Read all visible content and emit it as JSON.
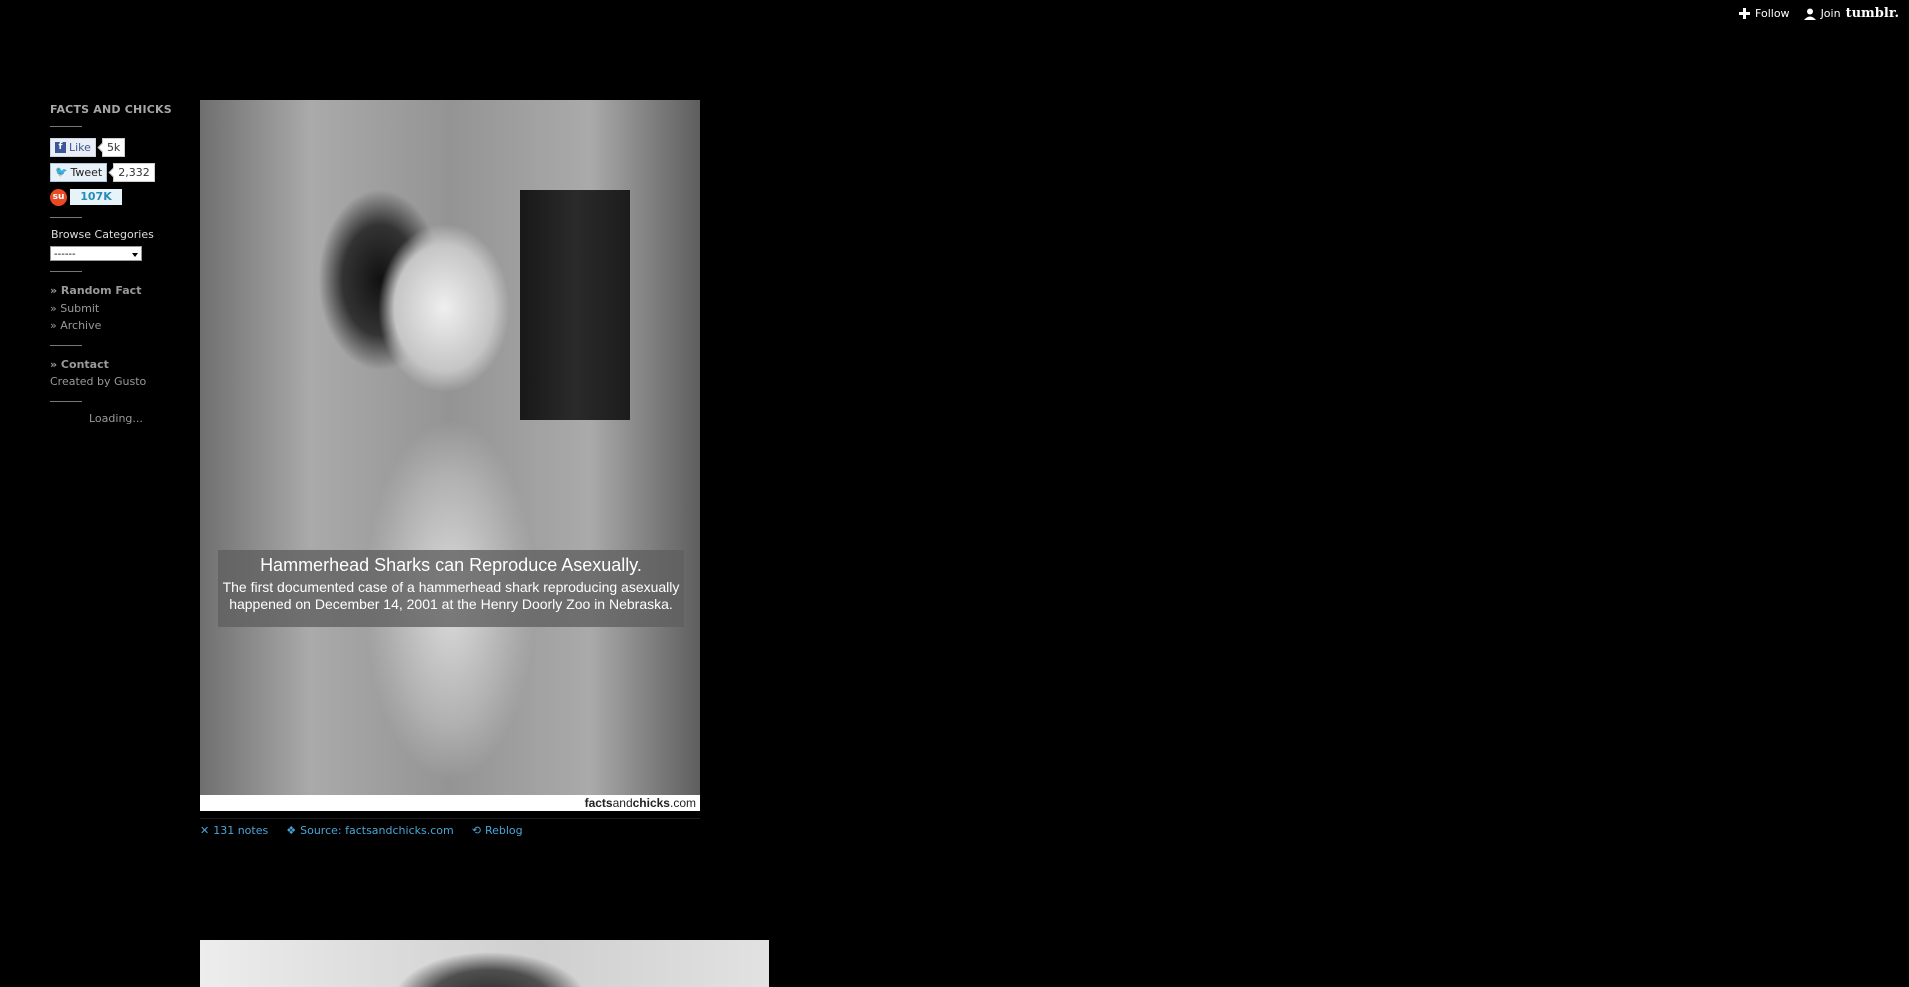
{
  "tumblr_controls": {
    "follow_label": "Follow",
    "join_label": "Join",
    "logo_text": "tumblr."
  },
  "sidebar": {
    "title": "FACTS AND CHICKS",
    "facebook": {
      "label": "Like",
      "count": "5k"
    },
    "twitter": {
      "label": "Tweet",
      "count": "2,332"
    },
    "stumbleupon": {
      "count": "107K"
    },
    "browse_label": "Browse Categories",
    "select_value": "------",
    "nav": {
      "random_fact": "» Random Fact",
      "submit": "» Submit",
      "archive": "» Archive",
      "contact": "» Contact",
      "created_by": "Created by Gusto"
    },
    "loading": "Loading..."
  },
  "post": {
    "caption_title": "Hammerhead Sharks can Reproduce Asexually.",
    "caption_line1": "The first documented case of a hammerhead shark reproducing asexually",
    "caption_line2": "happened on December 14, 2001 at the Henry Doorly Zoo in Nebraska.",
    "watermark_a": "facts",
    "watermark_b": "and",
    "watermark_c": "chicks",
    "watermark_d": ".com",
    "notes": "131 notes",
    "source": "Source: factsandchicks.com",
    "reblog": "Reblog"
  },
  "colors": {
    "background": "#000000",
    "link_blue": "#4aa5d6",
    "sidebar_text": "#999999"
  }
}
